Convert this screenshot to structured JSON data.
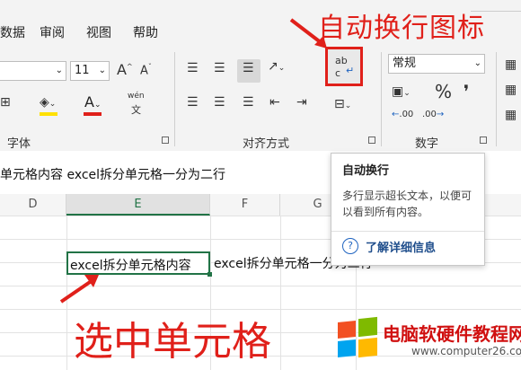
{
  "tabs": [
    "数据",
    "审阅",
    "视图",
    "帮助"
  ],
  "font": {
    "size": "11",
    "grow": "A",
    "shrink": "A",
    "phonetic_top": "wén",
    "phonetic_bottom": "文",
    "group_label": "字体"
  },
  "alignment": {
    "group_label": "对齐方式"
  },
  "number": {
    "format": "常规",
    "percent": "%",
    "comma": "❜",
    "inc_decimal": ".00",
    "dec_decimal": ".00",
    "group_label": "数字"
  },
  "wrap_icon_text": {
    "top": "ab",
    "bottom": "c"
  },
  "formula_bar": {
    "content": "单元格内容 excel拆分单元格一分为二行"
  },
  "columns": [
    "D",
    "E",
    "F",
    "G"
  ],
  "cell": {
    "value": "excel拆分单元格内容",
    "overflow": "excel拆分单元格一分为二行"
  },
  "tooltip": {
    "title": "自动换行",
    "body": "多行显示超长文本，以便可以看到所有内容。",
    "link": "了解详细信息",
    "help_icon": "?"
  },
  "annotations": {
    "wrap_icon_label": "自动换行图标",
    "select_cell_label": "选中单元格"
  },
  "watermark": {
    "text": "电脑软硬件教程网",
    "url": "www.computer26.com"
  },
  "colors": {
    "accent_red": "#e0201a",
    "selection_green": "#217346",
    "link_blue": "#1f4e8c"
  }
}
